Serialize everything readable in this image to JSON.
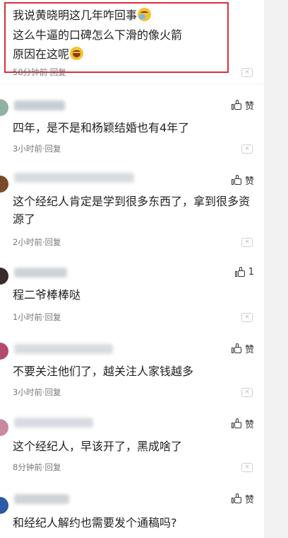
{
  "highlight": {
    "lines": [
      "我说黄晓明这几年咋回事",
      "这么牛逼的口碑怎么下滑的像火箭",
      "原因在这呢"
    ],
    "time": "58分钟前",
    "reply": "回复",
    "emoji": [
      "cry-laugh-icon",
      "laugh-icon"
    ]
  },
  "comments": [
    {
      "like_label": "赞",
      "text": "四年，是不是和杨颖结婚也有4年了",
      "time": "3小时前",
      "reply": "回复",
      "avatar_color": "#8fb3a0"
    },
    {
      "like_label": "赞",
      "text": "这个经纪人肯定是学到很多东西了，拿到很多资源了",
      "time": "2小时前",
      "reply": "回复",
      "avatar_color": "#7a4a2a"
    },
    {
      "like_label": "1",
      "text": "程二爷棒棒哒",
      "time": "1小时前",
      "reply": "回复",
      "avatar_color": "#3a2a2a"
    },
    {
      "like_label": "赞",
      "text": "不要关注他们了，越关注人家钱越多",
      "time": "3小时前",
      "reply": "回复",
      "avatar_color": "#b24a70"
    },
    {
      "like_label": "赞",
      "text": "这个经纪人，早该开了，黑成啥了",
      "time": "8分钟前",
      "reply": "回复",
      "avatar_color": "#c98aa0"
    },
    {
      "like_label": "赞",
      "text": "和经纪人解约也需要发个通稿吗?",
      "time": "",
      "reply": "",
      "avatar_color": "#2a5aa8"
    }
  ],
  "separator": "·",
  "close_glyph": "×"
}
